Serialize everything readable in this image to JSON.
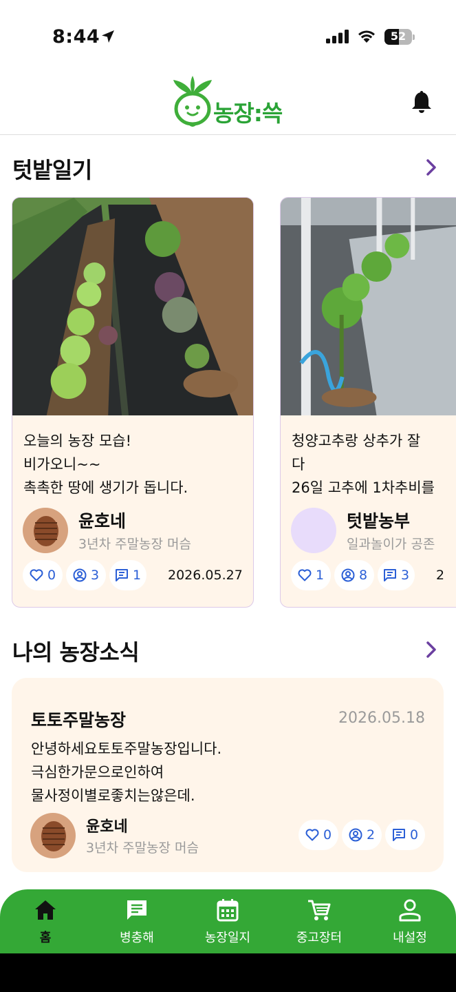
{
  "status_bar": {
    "time": "8:44",
    "battery": "52",
    "battery_level": 0.52
  },
  "header": {
    "logo_text": "농장:쓱",
    "brand_color": "#2aa336",
    "icons": [
      "logo-radish-icon",
      "bell-icon"
    ]
  },
  "diary": {
    "title": "텃밭일기",
    "cards": [
      {
        "text": "오늘의 농장 모습!\n비가오니~~\n촉촉한 땅에 생기가 돕니다.",
        "author": "윤호네",
        "subtitle": "3년차 주말농장 머슴",
        "likes": "0",
        "views": "3",
        "comments": "1",
        "date": "2026.05.27"
      },
      {
        "text": "청양고추랑 상추가 잘 \n다\n26일 고추에 1차추비를",
        "author": "텃밭농부",
        "subtitle": "일과놀이가 공존",
        "likes": "1",
        "views": "8",
        "comments": "3",
        "date": "2"
      }
    ]
  },
  "farm_news": {
    "title": "나의 농장소식",
    "item": {
      "farm_name": "토토주말농장",
      "date": "2026.05.18",
      "body": "안녕하세요토토주말농장입니다.\n극심한가문으로인하여\n물사정이별로좋치는않은데.",
      "author": "윤호네",
      "subtitle": "3년차 주말농장 머슴",
      "likes": "0",
      "views": "2",
      "comments": "0"
    }
  },
  "bottom_nav": {
    "items": [
      {
        "label": "홈",
        "icon": "home-icon",
        "active": true
      },
      {
        "label": "병충해",
        "icon": "message-icon"
      },
      {
        "label": "농장일지",
        "icon": "calendar-icon"
      },
      {
        "label": "중고장터",
        "icon": "cart-icon"
      },
      {
        "label": "내설정",
        "icon": "person-icon"
      }
    ]
  },
  "colors": {
    "accent_purple": "#6b3fa0",
    "card_bg": "#fff5ea",
    "nav_green": "#34a836",
    "stat_blue": "#2b5fd6"
  }
}
